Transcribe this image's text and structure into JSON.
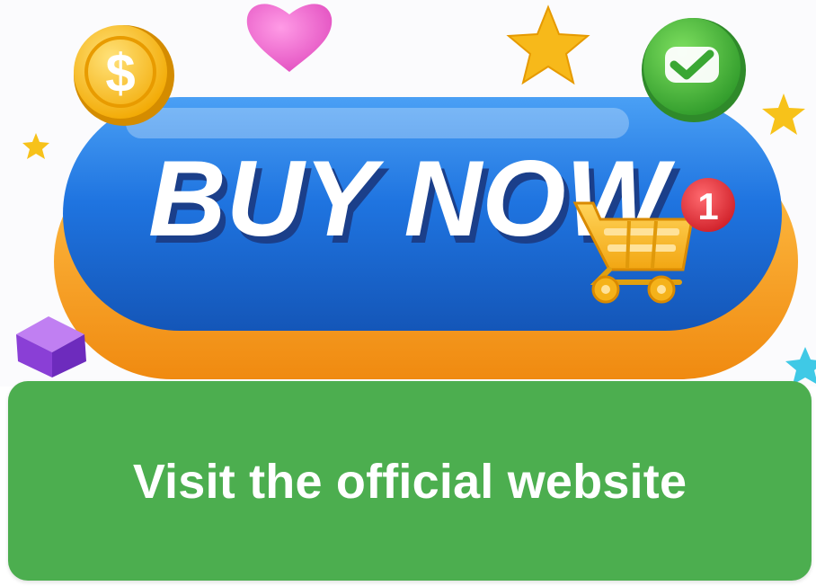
{
  "banner": {
    "headline": "BUY NOW",
    "cart_badge_count": "1",
    "coin_symbol": "$",
    "icons": [
      "dollar-coin-icon",
      "heart-icon",
      "star-icon",
      "check-circle-icon",
      "shopping-cart-icon",
      "cube-icon"
    ],
    "colors": {
      "pill_blue": "#1f74e0",
      "pill_base_orange": "#f7a21c",
      "coin_gold": "#f7c21a",
      "heart_pink": "#f06ad0",
      "check_green": "#4bb83a",
      "cube_purple": "#9b4de0",
      "badge_red": "#e8343a"
    }
  },
  "cta": {
    "label": "Visit the official website",
    "color": "#4cae4f"
  }
}
